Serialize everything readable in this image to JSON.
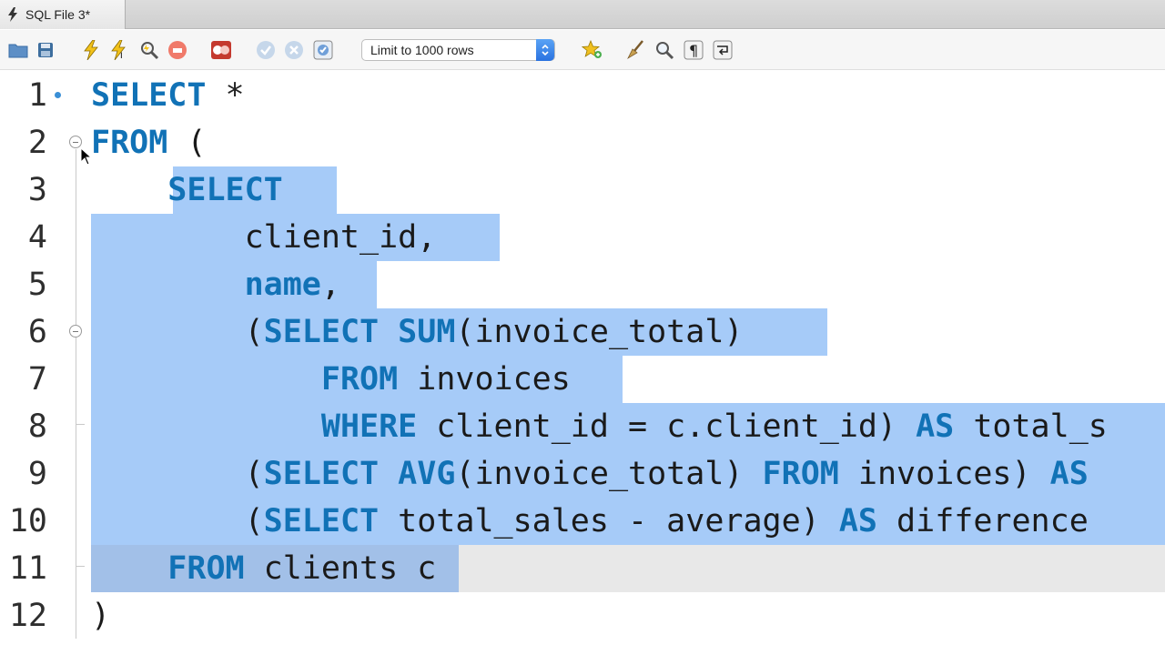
{
  "tab": {
    "title": "SQL File 3*"
  },
  "toolbar": {
    "limit_select": "Limit to 1000 rows",
    "icons": [
      "open-folder-icon",
      "save-icon",
      "execute-icon",
      "execute-current-icon",
      "explain-icon",
      "stop-icon",
      "stop-on-error-icon",
      "commit-icon",
      "rollback-icon",
      "autocommit-icon",
      "bookmark-star-icon",
      "beautify-broom-icon",
      "find-icon",
      "invisible-chars-icon",
      "word-wrap-icon"
    ]
  },
  "editor": {
    "line_numbers": [
      "1",
      "2",
      "3",
      "4",
      "5",
      "6",
      "7",
      "8",
      "9",
      "10",
      "11",
      "12"
    ],
    "lines": {
      "l1": {
        "kw1": "SELECT",
        "t1": " *"
      },
      "l2": {
        "kw1": "FROM",
        "t1": " ("
      },
      "l3": {
        "indent": "    ",
        "kw1": "SELECT"
      },
      "l4": {
        "indent": "        ",
        "t1": "client_id,"
      },
      "l5": {
        "indent": "        ",
        "kw1": "name",
        "t1": ","
      },
      "l6": {
        "indent": "        ",
        "t0": "(",
        "kw1": "SELECT",
        "t1": " ",
        "kw2": "SUM",
        "t2": "(invoice_total)"
      },
      "l7": {
        "indent": "            ",
        "kw1": "FROM",
        "t1": " invoices"
      },
      "l8": {
        "indent": "            ",
        "kw1": "WHERE",
        "t1": " client_id = c.client_id) ",
        "kw2": "AS",
        "t2": " total_s"
      },
      "l9": {
        "indent": "        ",
        "t0": "(",
        "kw1": "SELECT",
        "t1": " ",
        "kw2": "AVG",
        "t2": "(invoice_total) ",
        "kw3": "FROM",
        "t3": " invoices) ",
        "kw4": "AS"
      },
      "l10": {
        "indent": "        ",
        "t0": "(",
        "kw1": "SELECT",
        "t1": " total_sales - average) ",
        "kw2": "AS",
        "t2": " difference"
      },
      "l11": {
        "indent": "    ",
        "kw1": "FROM",
        "t1": " clients c"
      },
      "l12": {
        "t1": ")"
      }
    }
  },
  "colors": {
    "keyword": "#1172b6",
    "selection": "#a6cbf8",
    "text": "#1a1a1a"
  }
}
